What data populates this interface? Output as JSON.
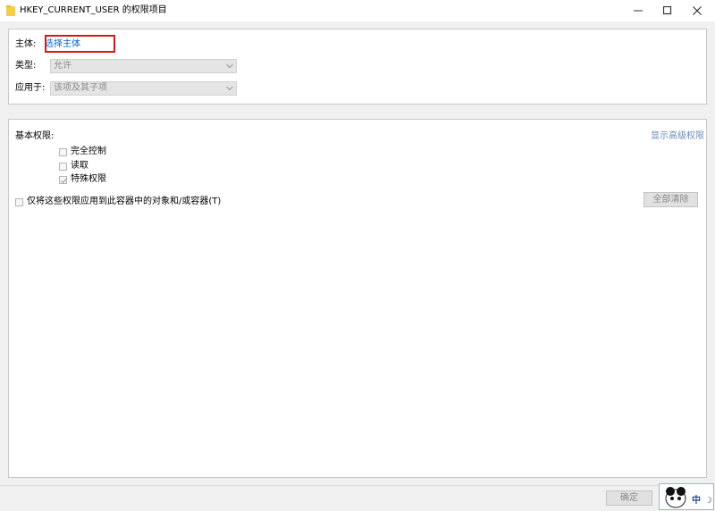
{
  "window": {
    "title": "HKEY_CURRENT_USER 的权限项目"
  },
  "principal": {
    "label": "主体:",
    "link": "选择主体"
  },
  "type": {
    "label": "类型:",
    "value": "允许"
  },
  "applies_to": {
    "label": "应用于:",
    "value": "该项及其子项"
  },
  "permissions": {
    "heading": "基本权限:",
    "show_advanced": "显示高级权限",
    "items": [
      {
        "label": "完全控制",
        "checked": false
      },
      {
        "label": "读取",
        "checked": false
      },
      {
        "label": "特殊权限",
        "checked": true
      }
    ],
    "apply_only_label": "仅将这些权限应用到此容器中的对象和/或容器(T)",
    "clear_all": "全部清除"
  },
  "footer": {
    "ok": "确定"
  },
  "ime": {
    "mode": "中",
    "symbol": "☽"
  },
  "colors": {
    "accent_link": "#0066cc",
    "highlight_box": "#d11a1a"
  }
}
